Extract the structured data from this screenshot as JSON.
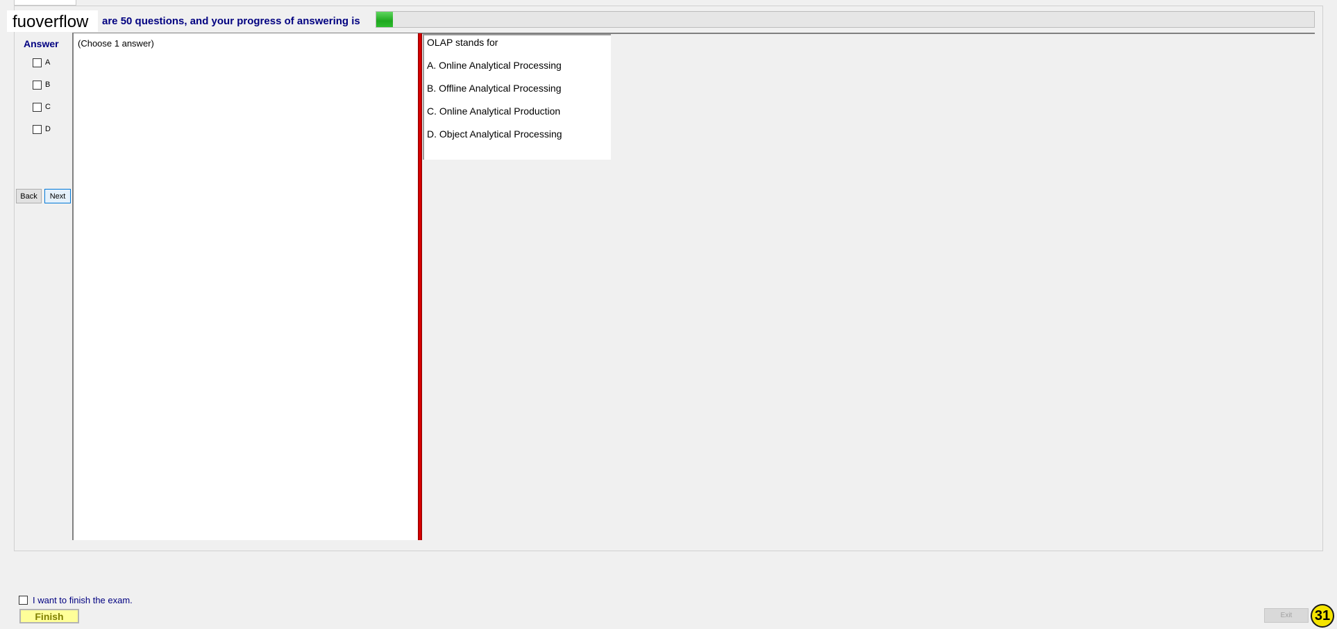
{
  "watermark": "fuoverflow",
  "header": {
    "progress_text": "are 50 questions, and your progress of answering is",
    "progress_fraction": 0.018
  },
  "answer_panel": {
    "title": "Answer",
    "options": [
      "A",
      "B",
      "C",
      "D"
    ],
    "back_label": "Back",
    "next_label": "Next"
  },
  "left_pane": {
    "instruction": "(Choose 1 answer)"
  },
  "question": {
    "text": "OLAP stands for",
    "choices": [
      "A.  Online Analytical Processing",
      "B.  Offline Analytical Processing",
      "C.  Online Analytical Production",
      "D.  Object Analytical Processing"
    ]
  },
  "footer": {
    "finish_checkbox_label": "I want to finish the exam.",
    "finish_label": "Finish",
    "exit_label": "Exit",
    "badge_number": "31"
  },
  "colors": {
    "accent_navy": "#000080",
    "progress_green": "#22aa22",
    "splitter_red": "#d40000",
    "finish_yellow": "#ffff99",
    "badge_yellow": "#f5e400"
  }
}
